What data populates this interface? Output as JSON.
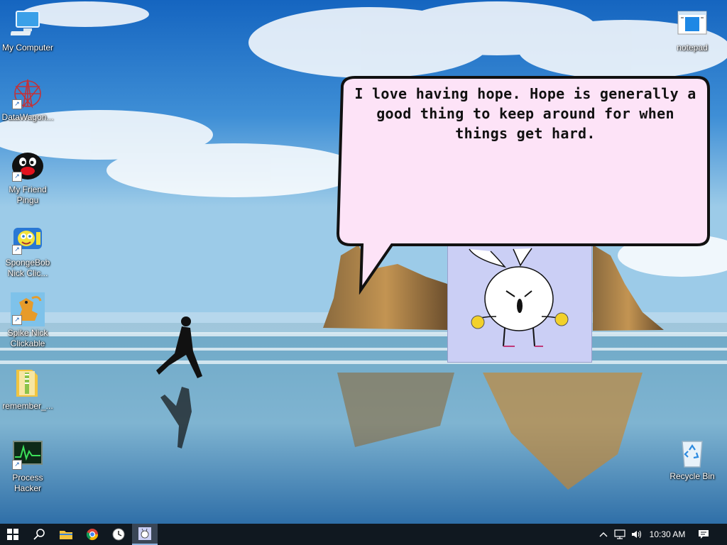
{
  "desktop": {
    "icons": [
      {
        "label": "My Computer",
        "icon": "computer-icon"
      },
      {
        "label": "DataWagon...",
        "icon": "datawagon-icon"
      },
      {
        "label": "My Friend Pingu",
        "icon": "pingu-icon"
      },
      {
        "label": "SpongeBob Nick Clic...",
        "icon": "spongebob-icon"
      },
      {
        "label": "Spike Nick Clickable",
        "icon": "spike-icon"
      },
      {
        "label": "remember_...",
        "icon": "folder-zip-icon"
      },
      {
        "label": "Process Hacker",
        "icon": "process-hacker-icon"
      },
      {
        "label": "notepad",
        "icon": "notepad-icon"
      },
      {
        "label": "Recycle Bin",
        "icon": "recycle-bin-icon"
      }
    ]
  },
  "buddy": {
    "speech": "I love having hope. Hope is generally a good thing to keep around for when things get hard."
  },
  "taskbar": {
    "pinned": [
      "start-icon",
      "search-icon",
      "file-explorer-icon",
      "chrome-icon",
      "clock-app-icon",
      "buddy-app-icon"
    ],
    "tray": [
      "chevron-up-icon",
      "network-icon",
      "volume-icon",
      "action-center-icon"
    ],
    "clock": "10:30 AM"
  },
  "colors": {
    "taskbar": "#101820",
    "bubble": "#fde3f7",
    "buddy_bg": "#cbcff5"
  }
}
